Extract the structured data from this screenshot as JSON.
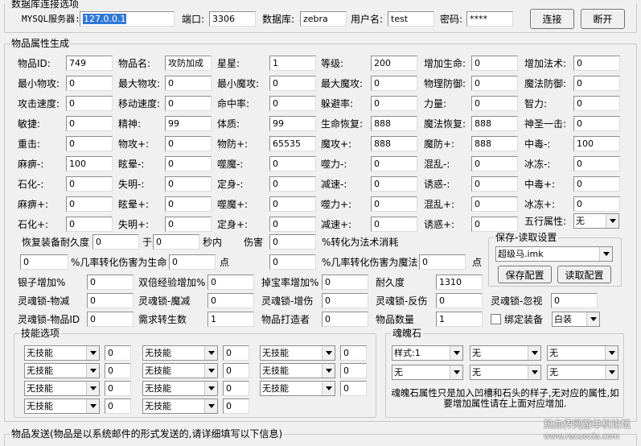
{
  "db": {
    "legend": "数据库连接选项",
    "server_label": "MYSQL服务器:",
    "server": "127.0.0.1",
    "port_label": "端口:",
    "port": "3306",
    "database_label": "数据库:",
    "database": "zebra",
    "user_label": "用户名:",
    "user": "test",
    "password_label": "密码:",
    "password": "****",
    "connect_label": "连接",
    "disconnect_label": "断开"
  },
  "attrs": {
    "legend": "物品属性生成",
    "grid": [
      [
        [
          "物品ID:",
          "749"
        ],
        [
          "物品名:",
          "攻防加成"
        ],
        [
          "星星:",
          "1"
        ],
        [
          "等级:",
          "200"
        ],
        [
          "增加生命:",
          "0"
        ],
        [
          "增加法术:",
          "0"
        ]
      ],
      [
        [
          "最小物攻:",
          "0"
        ],
        [
          "最大物攻:",
          "0"
        ],
        [
          "最小魔攻:",
          "0"
        ],
        [
          "最大魔攻:",
          "0"
        ],
        [
          "物理防御:",
          "0"
        ],
        [
          "魔法防御:",
          "0"
        ]
      ],
      [
        [
          "攻击速度:",
          "0"
        ],
        [
          "移动速度:",
          "0"
        ],
        [
          "命中率:",
          "0"
        ],
        [
          "躲避率:",
          "0"
        ],
        [
          "力量:",
          "0"
        ],
        [
          "智力:",
          "0"
        ]
      ],
      [
        [
          "敏捷:",
          "0"
        ],
        [
          "精神:",
          "99"
        ],
        [
          "体质:",
          "99"
        ],
        [
          "生命恢复:",
          "888"
        ],
        [
          "魔法恢复:",
          "888"
        ],
        [
          "神圣一击:",
          "0"
        ]
      ],
      [
        [
          "重击:",
          "0"
        ],
        [
          "物攻+:",
          "0"
        ],
        [
          "物防+:",
          "65535"
        ],
        [
          "魔攻+:",
          "888"
        ],
        [
          "魔防+:",
          "888"
        ],
        [
          "中毒-:",
          "100"
        ]
      ],
      [
        [
          "麻痹-:",
          "100"
        ],
        [
          "眩晕-:",
          "0"
        ],
        [
          "噬魔-:",
          "0"
        ],
        [
          "噬力-:",
          "0"
        ],
        [
          "混乱-:",
          "0"
        ],
        [
          "冰冻-:",
          "0"
        ]
      ],
      [
        [
          "石化-:",
          "0"
        ],
        [
          "失明-:",
          "0"
        ],
        [
          "定身-:",
          "0"
        ],
        [
          "减速-:",
          "0"
        ],
        [
          "诱惑-:",
          "0"
        ],
        [
          "中毒+:",
          "0"
        ]
      ],
      [
        [
          "麻痹+:",
          "0"
        ],
        [
          "眩晕+:",
          "0"
        ],
        [
          "噬魔+:",
          "0"
        ],
        [
          "噬力+:",
          "0"
        ],
        [
          "混乱+:",
          "0"
        ],
        [
          "冰冻+:",
          "0"
        ]
      ],
      [
        [
          "石化+:",
          "0"
        ],
        [
          "失明+:",
          "0"
        ],
        [
          "定身+:",
          "0"
        ],
        [
          "减速+:",
          "0"
        ],
        [
          "诱惑+:",
          "0"
        ]
      ]
    ],
    "five_element_label": "五行属性:",
    "five_element": "无",
    "restore_label": "恢复装备耐久度",
    "restore_value": "0",
    "restore_in": "于",
    "restore_secs": "0",
    "restore_unit": "秒内",
    "damage_label": "伤害",
    "damage_value": "0",
    "damage_suffix": "%转化为法术消耗",
    "pct_hp_value": "0",
    "pct_hp_label": "%几率转化伤害为生命",
    "pct_hp_points": "0",
    "point_label": "点",
    "pct_mp_value": "0",
    "pct_mp_label": "%几率转化伤害为魔法",
    "pct_mp_points": "0",
    "point_label2": "点",
    "row_a": [
      [
        "银子增加%",
        "0"
      ],
      [
        "双倍经验增加%",
        "0"
      ],
      [
        "掉宝率增加%",
        "0"
      ],
      [
        "耐久度",
        "1310"
      ]
    ],
    "row_b": [
      [
        "灵魂锁-物减",
        "0"
      ],
      [
        "灵魂锁-魔减",
        "0"
      ],
      [
        "灵魂锁-增伤",
        "0"
      ],
      [
        "灵魂锁-反伤",
        "0"
      ],
      [
        "灵魂锁-忽视",
        "0"
      ]
    ],
    "row_c": [
      [
        "灵魂锁-物品ID",
        "0"
      ],
      [
        "需求转生数",
        "1"
      ],
      [
        "物品打造者",
        "0"
      ],
      [
        "物品数量",
        "1"
      ]
    ],
    "bind_label": "绑定装备",
    "color_value": "白装"
  },
  "save": {
    "legend": "保存-读取设置",
    "file": "超级马.imk",
    "save_label": "保存配置",
    "load_label": "读取配置"
  },
  "skills": {
    "legend": "技能选项",
    "none": "无技能",
    "level": "0"
  },
  "soul": {
    "legend": "魂魄石",
    "style": "样式:1",
    "none": "无",
    "note": "魂魄石属性只是加入凹槽和石头的样子,无对应的属性,如要增加属性请在上面对应增加."
  },
  "send": {
    "legend": "物品发送(物品是以系统邮件的形式发送的,请详细填写以下信息)"
  },
  "watermark": {
    "line1": "热血传网游单机论坛",
    "line2": "www.rexuexia.com"
  }
}
